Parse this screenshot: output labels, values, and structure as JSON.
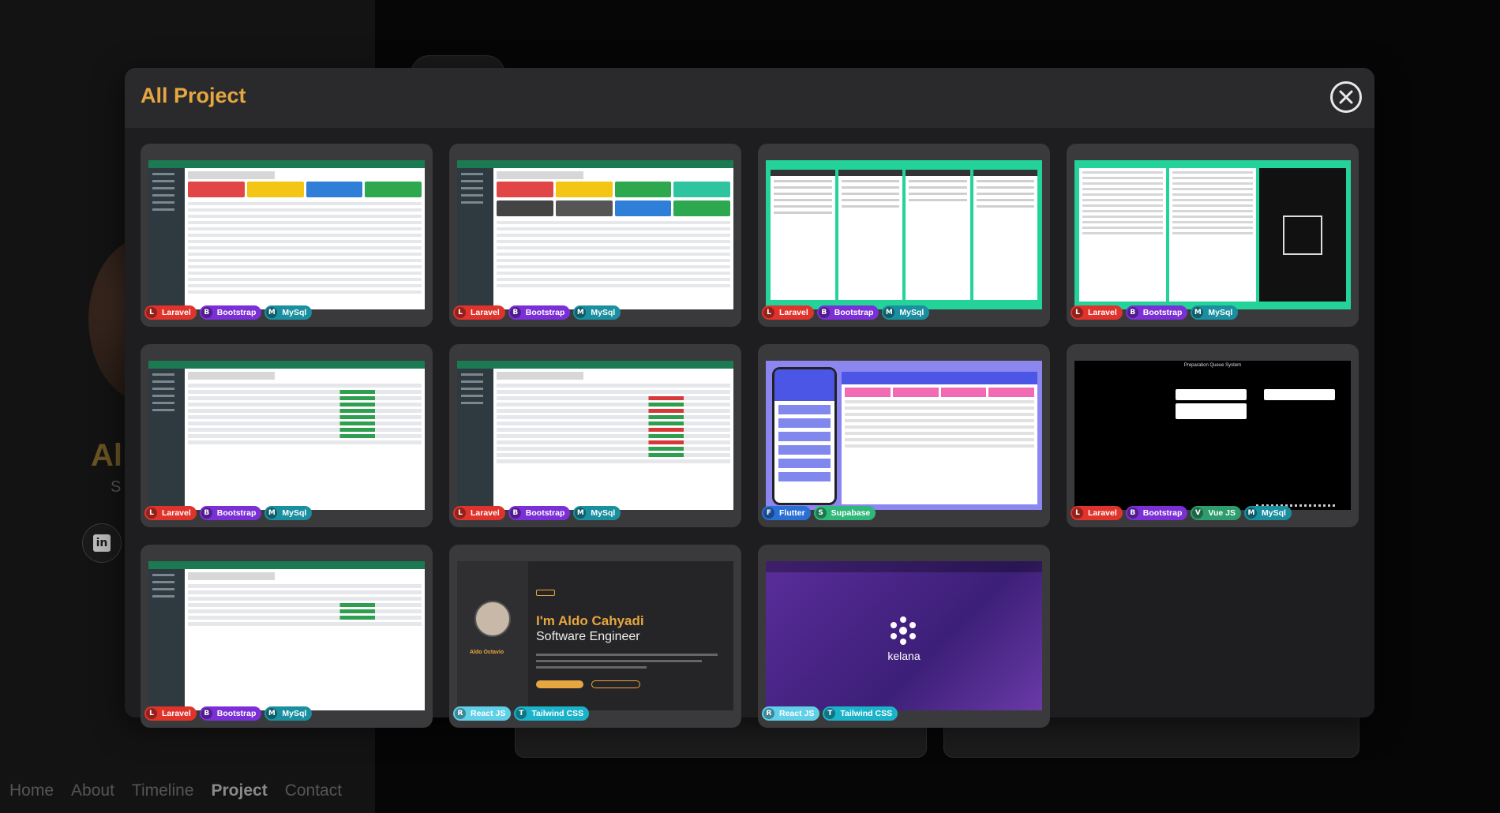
{
  "background": {
    "name_partial": "Al",
    "subtitle_partial": "S",
    "nav": [
      "Home",
      "About",
      "Timeline",
      "Project",
      "Contact"
    ],
    "nav_active": "Project"
  },
  "modal": {
    "title": "All Project",
    "close_icon": "close-circle-icon"
  },
  "projects": [
    {
      "thumb": "admin-dashboard",
      "tags": [
        "Laravel",
        "Bootstrap",
        "MySql"
      ]
    },
    {
      "thumb": "admin-dashboard-colored",
      "tags": [
        "Laravel",
        "Bootstrap",
        "MySql"
      ]
    },
    {
      "thumb": "mobile-screens",
      "tags": [
        "Laravel",
        "Bootstrap",
        "MySql"
      ]
    },
    {
      "thumb": "mobile-camera-screens",
      "tags": [
        "Laravel",
        "Bootstrap",
        "MySql"
      ]
    },
    {
      "thumb": "admin-table",
      "tags": [
        "Laravel",
        "Bootstrap",
        "MySql"
      ]
    },
    {
      "thumb": "admin-table-status",
      "tags": [
        "Laravel",
        "Bootstrap",
        "MySql"
      ]
    },
    {
      "thumb": "flutter-app",
      "tags": [
        "Flutter",
        "Supabase"
      ]
    },
    {
      "thumb": "queue-system",
      "tags": [
        "Laravel",
        "Bootstrap",
        "Vue JS",
        "MySql"
      ]
    },
    {
      "thumb": "admin-planning",
      "tags": [
        "Laravel",
        "Bootstrap",
        "MySql"
      ]
    },
    {
      "thumb": "portfolio",
      "tags": [
        "React JS",
        "Tailwind CSS"
      ]
    },
    {
      "thumb": "kelana",
      "tags": [
        "React JS",
        "Tailwind CSS"
      ]
    }
  ],
  "thumb_text": {
    "portfolio_headline": "I'm Aldo Cahyadi",
    "portfolio_role": "Software Engineer",
    "portfolio_name": "Aldo Octavio",
    "queue_title": "Preparation Queue System",
    "kelana_brand": "kelana"
  },
  "tag_colors": {
    "Laravel": "#e0332b",
    "Bootstrap": "#7b2fd6",
    "MySql": "#1a8fa0",
    "Flutter": "#2a6fd6",
    "Supabase": "#2fb87a",
    "Vue JS": "#2e9c6c",
    "React JS": "#5fd0e8",
    "Tailwind CSS": "#1bb3c9"
  },
  "tag_icons": {
    "Laravel": "laravel-icon",
    "Bootstrap": "bootstrap-icon",
    "MySql": "mysql-icon",
    "Flutter": "flutter-icon",
    "Supabase": "supabase-icon",
    "Vue JS": "vue-icon",
    "React JS": "react-icon",
    "Tailwind CSS": "tailwind-icon"
  },
  "accent": "#e6a640"
}
